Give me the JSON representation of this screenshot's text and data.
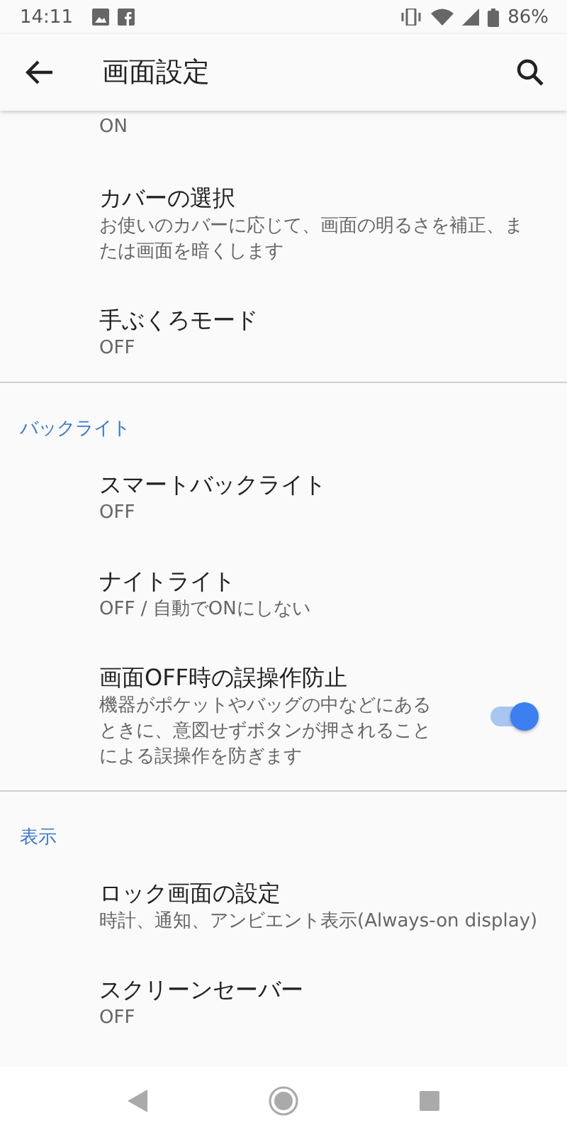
{
  "status_bar": {
    "time": "14:11",
    "battery": "86%"
  },
  "app_bar": {
    "title": "画面設定"
  },
  "sections": [
    {
      "items": [
        {
          "kind": "text",
          "summary": "ON"
        },
        {
          "kind": "text",
          "title": "カバーの選択",
          "summary": "お使いのカバーに応じて、画面の明るさを補正、または画面を暗くします"
        },
        {
          "kind": "text",
          "title": "手ぶくろモード",
          "summary": "OFF"
        }
      ]
    },
    {
      "header": "バックライト",
      "items": [
        {
          "kind": "text",
          "title": "スマートバックライト",
          "summary": "OFF"
        },
        {
          "kind": "text",
          "title": "ナイトライト",
          "summary": "OFF / 自動でONにしない"
        },
        {
          "kind": "switch",
          "title": "画面OFF時の誤操作防止",
          "summary": "機器がポケットやバッグの中などにあるときに、意図せずボタンが押されることによる誤操作を防ぎます",
          "on": true
        }
      ]
    },
    {
      "header": "表示",
      "items": [
        {
          "kind": "text",
          "title": "ロック画面の設定",
          "summary": "時計、通知、アンビエント表示(Always-on display)"
        },
        {
          "kind": "text",
          "title": "スクリーンセーバー",
          "summary": "OFF"
        }
      ]
    }
  ]
}
